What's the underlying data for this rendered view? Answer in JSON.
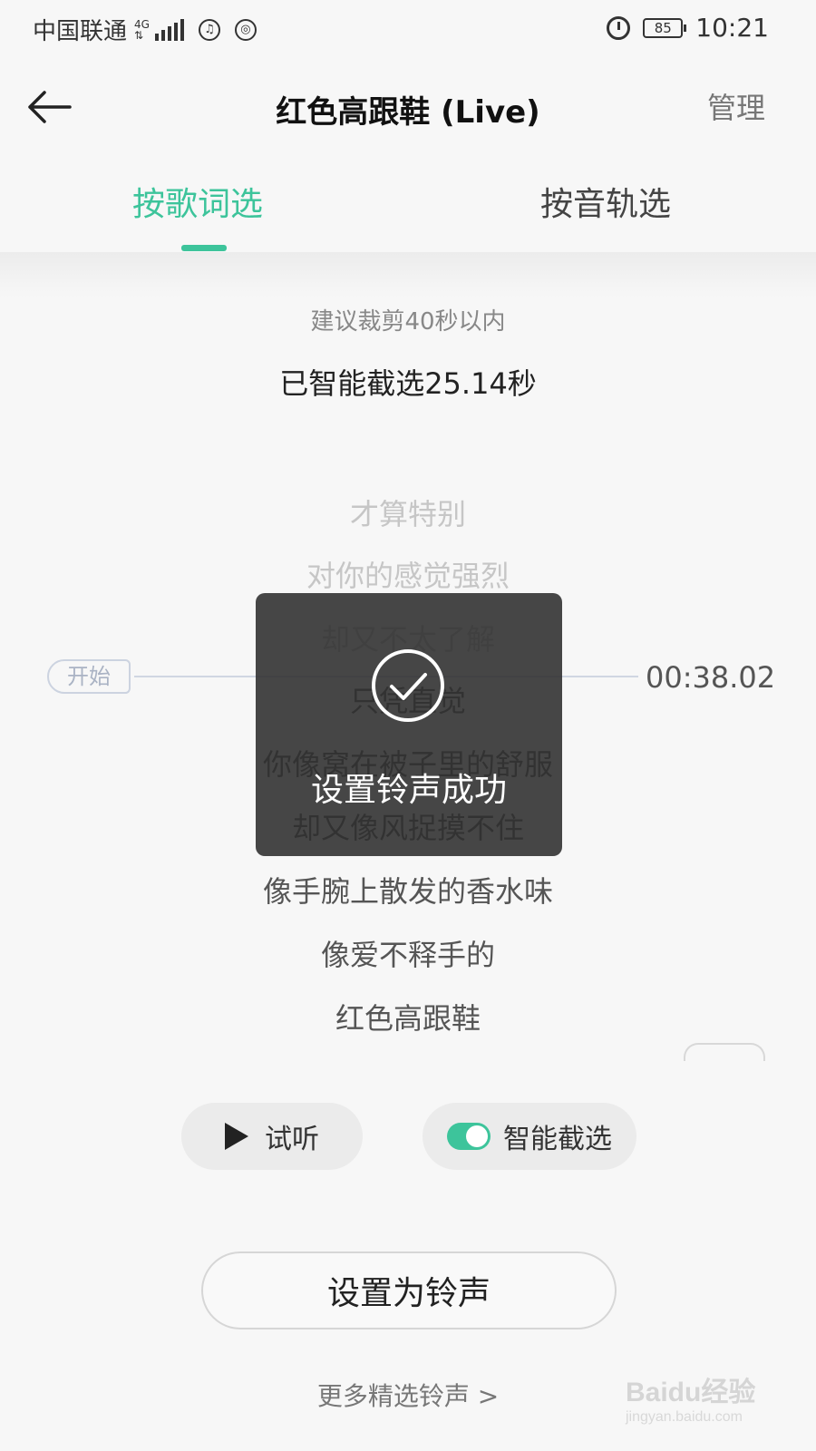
{
  "status_bar": {
    "carrier": "中国联通",
    "network": "4G",
    "battery": "85",
    "time": "10:21"
  },
  "header": {
    "title": "红色高跟鞋 (Live)",
    "manage_label": "管理"
  },
  "tabs": [
    {
      "label": "按歌词选",
      "active": true
    },
    {
      "label": "按音轨选",
      "active": false
    }
  ],
  "clip": {
    "hint": "建议裁剪40秒以内",
    "selected_info": "已智能截选25.14秒",
    "start_label": "开始",
    "end_time": "00:38.02"
  },
  "lyrics": [
    {
      "text": "才算特别",
      "dim": true
    },
    {
      "text": "对你的感觉强烈",
      "dim": true
    },
    {
      "text": "却又不太了解",
      "dim": false
    },
    {
      "text": "只凭直觉",
      "dim": false
    },
    {
      "text": "你像窝在被子里的舒服",
      "dim": false
    },
    {
      "text": "却又像风捉摸不住",
      "dim": false
    },
    {
      "text": "像手腕上散发的香水味",
      "dim": false
    },
    {
      "text": "像爱不释手的",
      "dim": false
    },
    {
      "text": "红色高跟鞋",
      "dim": false
    }
  ],
  "toast": {
    "message": "设置铃声成功",
    "icon": "check-circle-icon"
  },
  "controls": {
    "preview_label": "试听",
    "smart_clip_label": "智能截选",
    "smart_clip_on": true
  },
  "set_ringtone_label": "设置为铃声",
  "more_link": "更多精选铃声 >",
  "watermark": {
    "main": "Baidu经验",
    "sub": "jingyan.baidu.com"
  },
  "colors": {
    "accent": "#3dc49b",
    "toast_bg": "#2d2d2d",
    "background": "#f7f7f7"
  }
}
